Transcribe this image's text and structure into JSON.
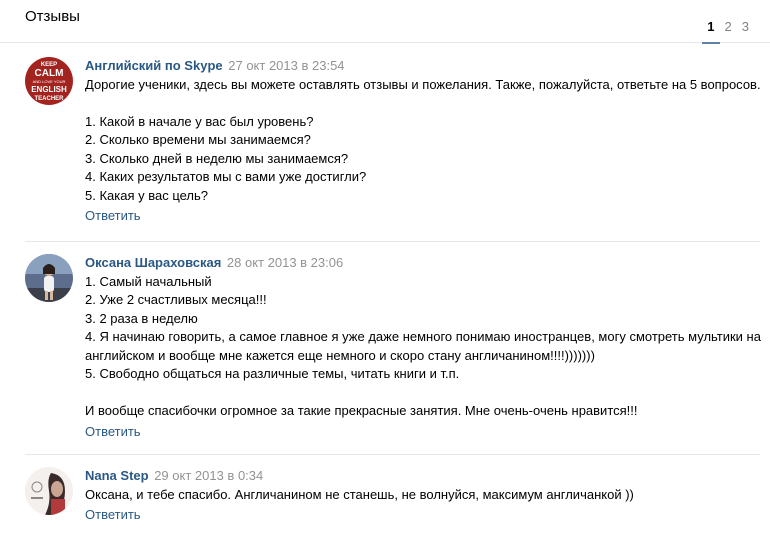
{
  "section_title": "Отзывы",
  "pages": [
    "1",
    "2",
    "3"
  ],
  "comments": [
    {
      "author": "Английский по Skype",
      "date": "27 окт 2013 в 23:54",
      "lines": [
        "Дорогие ученики, здесь вы можете оставлять отзывы и пожелания. Также, пожалуйста, ответьте на 5 вопросов.",
        "",
        "1. Какой в начале у вас был уровень?",
        "2. Сколько времени мы занимаемся?",
        "3. Сколько дней в неделю мы занимаемся?",
        "4. Каких результатов мы с вами уже достигли?",
        "5. Какая у вас цель?"
      ],
      "reply": "Ответить",
      "avatar_text": [
        "KEEP",
        "CALM",
        "AND LOVE YOUR",
        "ENGLISH",
        "TEACHER"
      ]
    },
    {
      "author": "Оксана Шараховская",
      "date": "28 окт 2013 в 23:06",
      "lines": [
        "1. Самый начальный",
        "2. Уже 2 счастливых месяца!!!",
        "3. 2 раза в неделю",
        "4. Я начинаю говорить, а самое главное я уже даже немного понимаю иностранцев, могу смотреть мультики на",
        "английском и вообще мне кажется еще немного и скоро стану англичанином!!!!)))))))",
        "5. Свободно общаться на различные темы, читать книги и т.п.",
        "",
        "И вообще спасибочки огромное за такие прекрасные занятия. Мне очень-очень нравится!!!"
      ],
      "reply": "Ответить"
    },
    {
      "author": "Nana Step",
      "date": "29 окт 2013 в 0:34",
      "lines": [
        "Оксана, и тебе спасибо. Англичанином не станешь, не волнуйся, максимум англичанкой ))"
      ],
      "reply": "Ответить"
    }
  ]
}
